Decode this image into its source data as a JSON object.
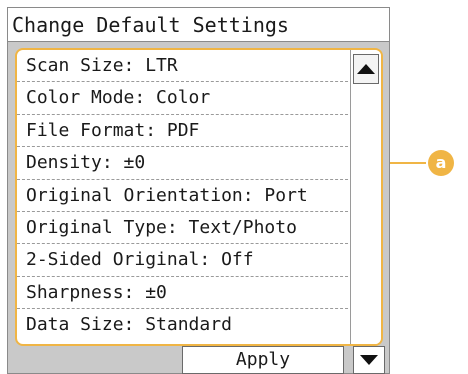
{
  "title": "Change Default Settings",
  "settings": [
    {
      "label": "Scan Size: LTR"
    },
    {
      "label": "Color Mode: Color"
    },
    {
      "label": "File Format: PDF"
    },
    {
      "label": "Density: ±0"
    },
    {
      "label": "Original Orientation: Port"
    },
    {
      "label": "Original Type: Text/Photo"
    },
    {
      "label": "2-Sided Original: Off"
    },
    {
      "label": "Sharpness: ±0"
    },
    {
      "label": "Data Size: Standard"
    }
  ],
  "apply_label": "Apply",
  "callout_label": "a",
  "colors": {
    "highlight": "#f0b545",
    "panel_gray": "#c9c9c9"
  },
  "icons": {
    "scroll_up": "triangle-up-icon",
    "scroll_down": "triangle-down-icon"
  }
}
